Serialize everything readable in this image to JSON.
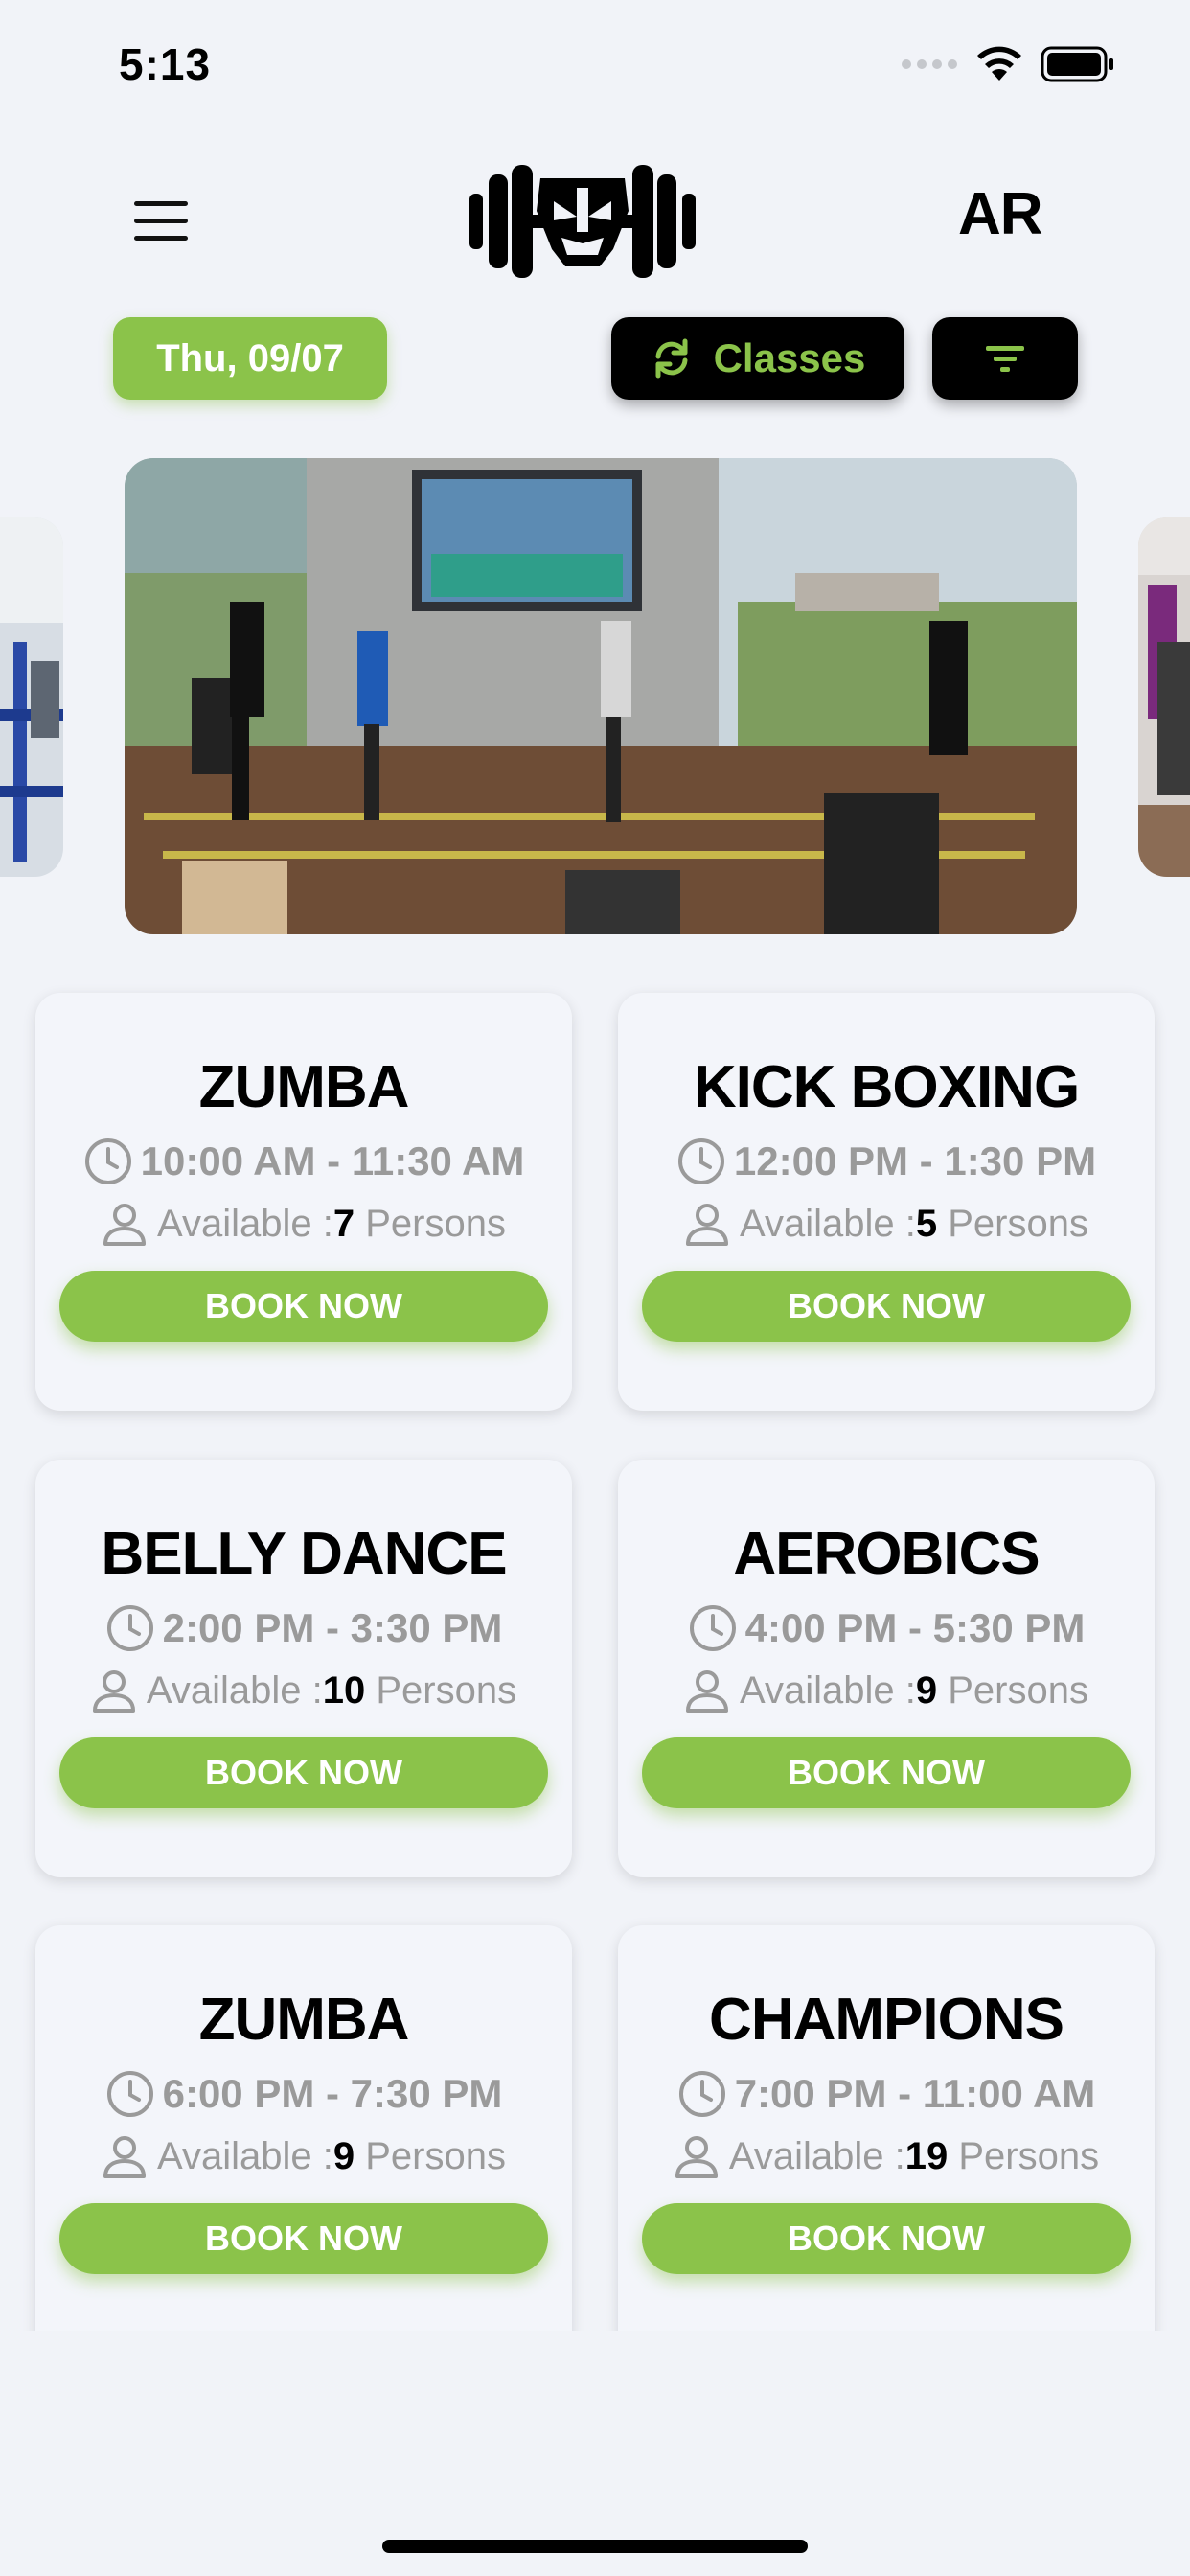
{
  "status_bar": {
    "time": "5:13"
  },
  "header": {
    "menu_icon": "hamburger-menu-icon",
    "logo": "gym-logo",
    "language_label": "AR"
  },
  "controls": {
    "date_label": "Thu, 09/07",
    "classes_label": "Classes",
    "classes_icon": "refresh-icon",
    "filter_icon": "filter-icon"
  },
  "colors": {
    "accent": "#8bc34a",
    "background": "#f1f3f8",
    "dark": "#000000",
    "muted_text": "#9a9a9a"
  },
  "classes": [
    {
      "name": "ZUMBA",
      "time": "10:00 AM - 11:30 AM",
      "available_prefix": "Available :",
      "count": "7",
      "suffix": "Persons",
      "button": "BOOK NOW"
    },
    {
      "name": "KICK BOXING",
      "time": "12:00 PM - 1:30 PM",
      "available_prefix": "Available :",
      "count": "5",
      "suffix": "Persons",
      "button": "BOOK NOW"
    },
    {
      "name": "BELLY DANCE",
      "time": "2:00 PM - 3:30 PM",
      "available_prefix": "Available :",
      "count": "10",
      "suffix": "Persons",
      "button": "BOOK NOW"
    },
    {
      "name": "AEROBICS",
      "time": "4:00 PM - 5:30 PM",
      "available_prefix": "Available :",
      "count": "9",
      "suffix": "Persons",
      "button": "BOOK NOW"
    },
    {
      "name": "ZUMBA",
      "time": "6:00 PM - 7:30 PM",
      "available_prefix": "Available :",
      "count": "9",
      "suffix": "Persons",
      "button": "BOOK NOW"
    },
    {
      "name": "CHAMPIONS",
      "time": "7:00 PM - 11:00 AM",
      "available_prefix": "Available :",
      "count": "19",
      "suffix": "Persons",
      "button": "BOOK NOW"
    }
  ]
}
